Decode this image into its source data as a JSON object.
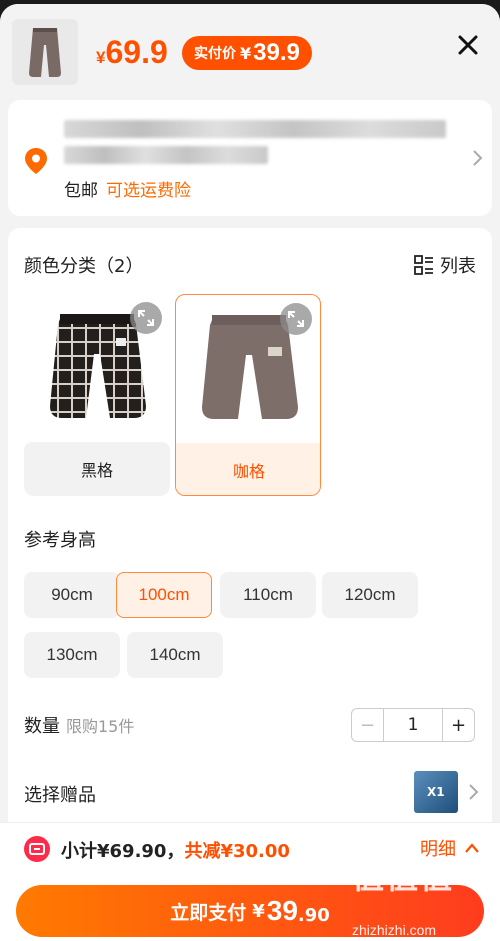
{
  "header": {
    "price_currency": "¥",
    "price": "69.9",
    "real_price_label": "实付价",
    "real_price_currency": "¥",
    "real_price": "39.9"
  },
  "address": {
    "shipping_free": "包邮",
    "shipping_insurance": "可选运费险"
  },
  "color_section": {
    "title": "颜色分类（2）",
    "list_toggle": "列表",
    "options": [
      {
        "label": "黑格",
        "selected": false
      },
      {
        "label": "咖格",
        "selected": true
      }
    ]
  },
  "size_section": {
    "title": "参考身高",
    "options": [
      "90cm",
      "100cm",
      "110cm",
      "120cm",
      "130cm",
      "140cm"
    ],
    "selected": "100cm"
  },
  "quantity": {
    "label": "数量",
    "limit": "限购15件",
    "minus": "−",
    "value": "1",
    "plus": "+"
  },
  "gift": {
    "label": "选择赠品",
    "badge": "X1"
  },
  "summary": {
    "subtotal": "小计¥69.90，",
    "discount": "共减¥30.00",
    "detail": "明细"
  },
  "pay_button": {
    "label": "立即支付",
    "currency": "¥",
    "amount": "39",
    "decimal": ".90"
  },
  "watermark": {
    "line1": "值值值",
    "line2": "zhizhizhi.com"
  },
  "colors": {
    "accent": "#ff5000",
    "selected_bg": "#fff1e6",
    "coupon": "#ff2a4a"
  }
}
